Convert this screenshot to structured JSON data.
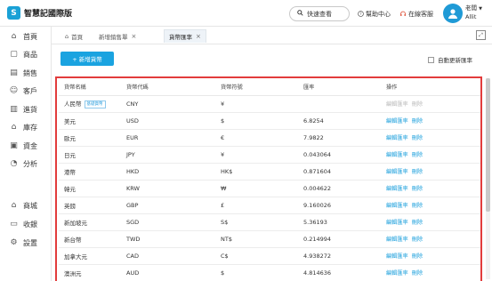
{
  "app": {
    "logo_glyph": "S",
    "name": "智慧記國際版"
  },
  "header": {
    "search_label": "快速查看",
    "help_label": "幫助中心",
    "service_label": "在線客服",
    "user_name": "老闆",
    "user_sub": "Allit"
  },
  "sidebar": {
    "items": [
      {
        "label": "首頁",
        "icon": "home-icon",
        "glyph": "⌂"
      },
      {
        "label": "商品",
        "icon": "box-icon",
        "glyph": "▢"
      },
      {
        "label": "銷售",
        "icon": "sales-icon",
        "glyph": "▤"
      },
      {
        "label": "客戶",
        "icon": "user-icon",
        "glyph": "☺"
      },
      {
        "label": "進貨",
        "icon": "purchase-icon",
        "glyph": "▥"
      },
      {
        "label": "庫存",
        "icon": "warehouse-icon",
        "glyph": "⌂"
      },
      {
        "label": "資金",
        "icon": "money-icon",
        "glyph": "▣"
      },
      {
        "label": "分析",
        "icon": "analysis-icon",
        "glyph": "◔"
      },
      {
        "label": "商城",
        "icon": "shop-icon",
        "glyph": "⌂"
      },
      {
        "label": "收銀",
        "icon": "cashier-icon",
        "glyph": "▭"
      },
      {
        "label": "設置",
        "icon": "settings-icon",
        "glyph": "⚙"
      }
    ]
  },
  "tabs": {
    "home": "首頁",
    "items": [
      {
        "label": "新增銷售單"
      },
      {
        "label": "貨幣匯率"
      }
    ]
  },
  "toolbar": {
    "add_label": "+ 新增貨幣",
    "auto_update_label": "自動更新匯率"
  },
  "table": {
    "columns": [
      "貨幣名稱",
      "貨幣代碼",
      "貨幣符號",
      "匯率",
      "操作"
    ],
    "base_tag": "基礎貨幣",
    "edit_label": "編輯匯率",
    "delete_label": "刪除",
    "rows": [
      {
        "name": "人民幣",
        "code": "CNY",
        "symbol": "¥",
        "rate": "",
        "base": true
      },
      {
        "name": "美元",
        "code": "USD",
        "symbol": "$",
        "rate": "6.8254"
      },
      {
        "name": "歐元",
        "code": "EUR",
        "symbol": "€",
        "rate": "7.9822"
      },
      {
        "name": "日元",
        "code": "JPY",
        "symbol": "¥",
        "rate": "0.043064"
      },
      {
        "name": "港幣",
        "code": "HKD",
        "symbol": "HK$",
        "rate": "0.871604"
      },
      {
        "name": "韓元",
        "code": "KRW",
        "symbol": "₩",
        "rate": "0.004622"
      },
      {
        "name": "英鎊",
        "code": "GBP",
        "symbol": "£",
        "rate": "9.160026"
      },
      {
        "name": "新加坡元",
        "code": "SGD",
        "symbol": "S$",
        "rate": "5.36193"
      },
      {
        "name": "新台幣",
        "code": "TWD",
        "symbol": "NT$",
        "rate": "0.214994"
      },
      {
        "name": "加拿大元",
        "code": "CAD",
        "symbol": "C$",
        "rate": "4.938272"
      },
      {
        "name": "澳洲元",
        "code": "AUD",
        "symbol": "$",
        "rate": "4.814636"
      }
    ]
  }
}
